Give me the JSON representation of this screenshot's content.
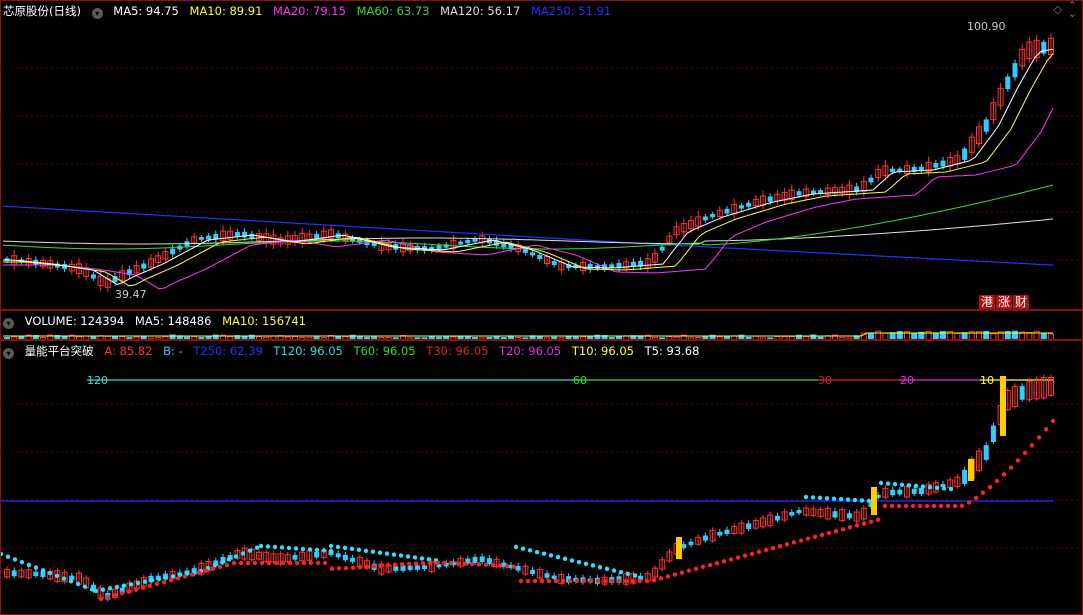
{
  "main": {
    "title": "芯原股份(日线)",
    "ma": [
      {
        "label": "MA5: 94.75",
        "color": "#ffffff"
      },
      {
        "label": "MA10: 89.91",
        "color": "#ffff33"
      },
      {
        "label": "MA20: 79.15",
        "color": "#ff33ff"
      },
      {
        "label": "MA60: 63.73",
        "color": "#33dd33"
      },
      {
        "label": "MA120: 56.17",
        "color": "#dddddd"
      },
      {
        "label": "MA250: 51.91",
        "color": "#2233ff"
      }
    ],
    "high_label": "100.90",
    "low_label": "39.47",
    "tags": [
      "港",
      "涨",
      "财"
    ]
  },
  "volume": {
    "items": [
      {
        "label": "VOLUME: 124394",
        "color": "#ffffff"
      },
      {
        "label": "MA5: 148486",
        "color": "#ffffff"
      },
      {
        "label": "MA10: 156741",
        "color": "#ffff33"
      }
    ]
  },
  "indicator": {
    "title": "量能平台突破",
    "items": [
      {
        "label": "A: 85.82",
        "color": "#ff3333"
      },
      {
        "label": "B: -",
        "color": "#33ccff"
      },
      {
        "label": "T250: 62.39",
        "color": "#2233ff"
      },
      {
        "label": "T120: 96.05",
        "color": "#33dddd"
      },
      {
        "label": "T60: 96.05",
        "color": "#33dd33"
      },
      {
        "label": "T30: 96.05",
        "color": "#dd2222"
      },
      {
        "label": "T20: 96.05",
        "color": "#dd33dd"
      },
      {
        "label": "T10: 96.05",
        "color": "#ffff33"
      },
      {
        "label": "T5: 93.68",
        "color": "#ffffff"
      }
    ],
    "level_labels": [
      "120",
      "60",
      "30",
      "20",
      "10"
    ]
  },
  "colors": {
    "up": "#ff3333",
    "down": "#33ccff",
    "grid": "#5a0000",
    "border": "#8a1010"
  },
  "icons": {
    "menu": "circle-down-icon",
    "controls": [
      "diamond-icon",
      "up-caret-icon",
      "down-caret-icon"
    ]
  }
}
